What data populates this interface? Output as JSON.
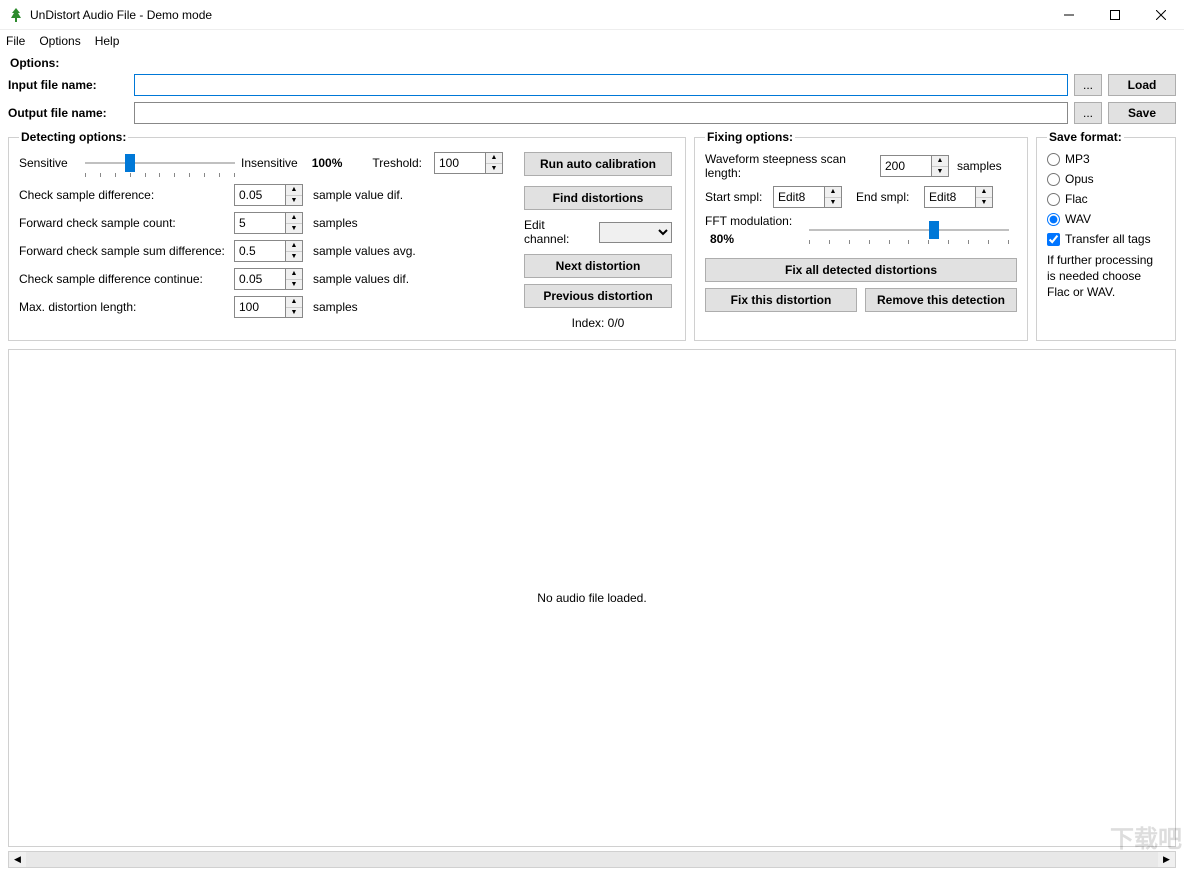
{
  "window": {
    "title": "UnDistort Audio File - Demo mode"
  },
  "menu": {
    "file": "File",
    "options": "Options",
    "help": "Help"
  },
  "options": {
    "header": "Options:",
    "input_label": "Input file name:",
    "output_label": "Output file name:",
    "input_value": "",
    "output_value": "",
    "browse": "...",
    "load": "Load",
    "save": "Save"
  },
  "detecting": {
    "legend": "Detecting options:",
    "sensitive": "Sensitive",
    "insensitive": "Insensitive",
    "pct": "100%",
    "threshold_label": "Treshold:",
    "threshold_value": "100",
    "rows": [
      {
        "label": "Check sample difference:",
        "value": "0.05",
        "unit": "sample value dif."
      },
      {
        "label": "Forward check sample count:",
        "value": "5",
        "unit": "samples"
      },
      {
        "label": "Forward check sample sum difference:",
        "value": "0.5",
        "unit": "sample values avg."
      },
      {
        "label": "Check sample difference continue:",
        "value": "0.05",
        "unit": "sample values dif."
      },
      {
        "label": "Max. distortion length:",
        "value": "100",
        "unit": "samples"
      }
    ],
    "run_auto": "Run auto calibration",
    "find": "Find distortions",
    "edit_channel": "Edit channel:",
    "next": "Next distortion",
    "prev": "Previous distortion",
    "index": "Index: 0/0"
  },
  "fixing": {
    "legend": "Fixing options:",
    "scan_label": "Waveform steepness scan length:",
    "scan_value": "200",
    "scan_unit": "samples",
    "start_label": "Start smpl:",
    "start_value": "Edit8",
    "end_label": "End smpl:",
    "end_value": "Edit8",
    "fft_label": "FFT modulation:",
    "fft_pct": "80%",
    "fix_all": "Fix all detected distortions",
    "fix_this": "Fix this distortion",
    "remove": "Remove this detection"
  },
  "save": {
    "legend": "Save format:",
    "formats": [
      "MP3",
      "Opus",
      "Flac",
      "WAV"
    ],
    "selected": "WAV",
    "transfer": "Transfer all tags",
    "note": "If further processing is needed choose Flac or WAV."
  },
  "waveform": {
    "empty": "No audio file loaded."
  }
}
